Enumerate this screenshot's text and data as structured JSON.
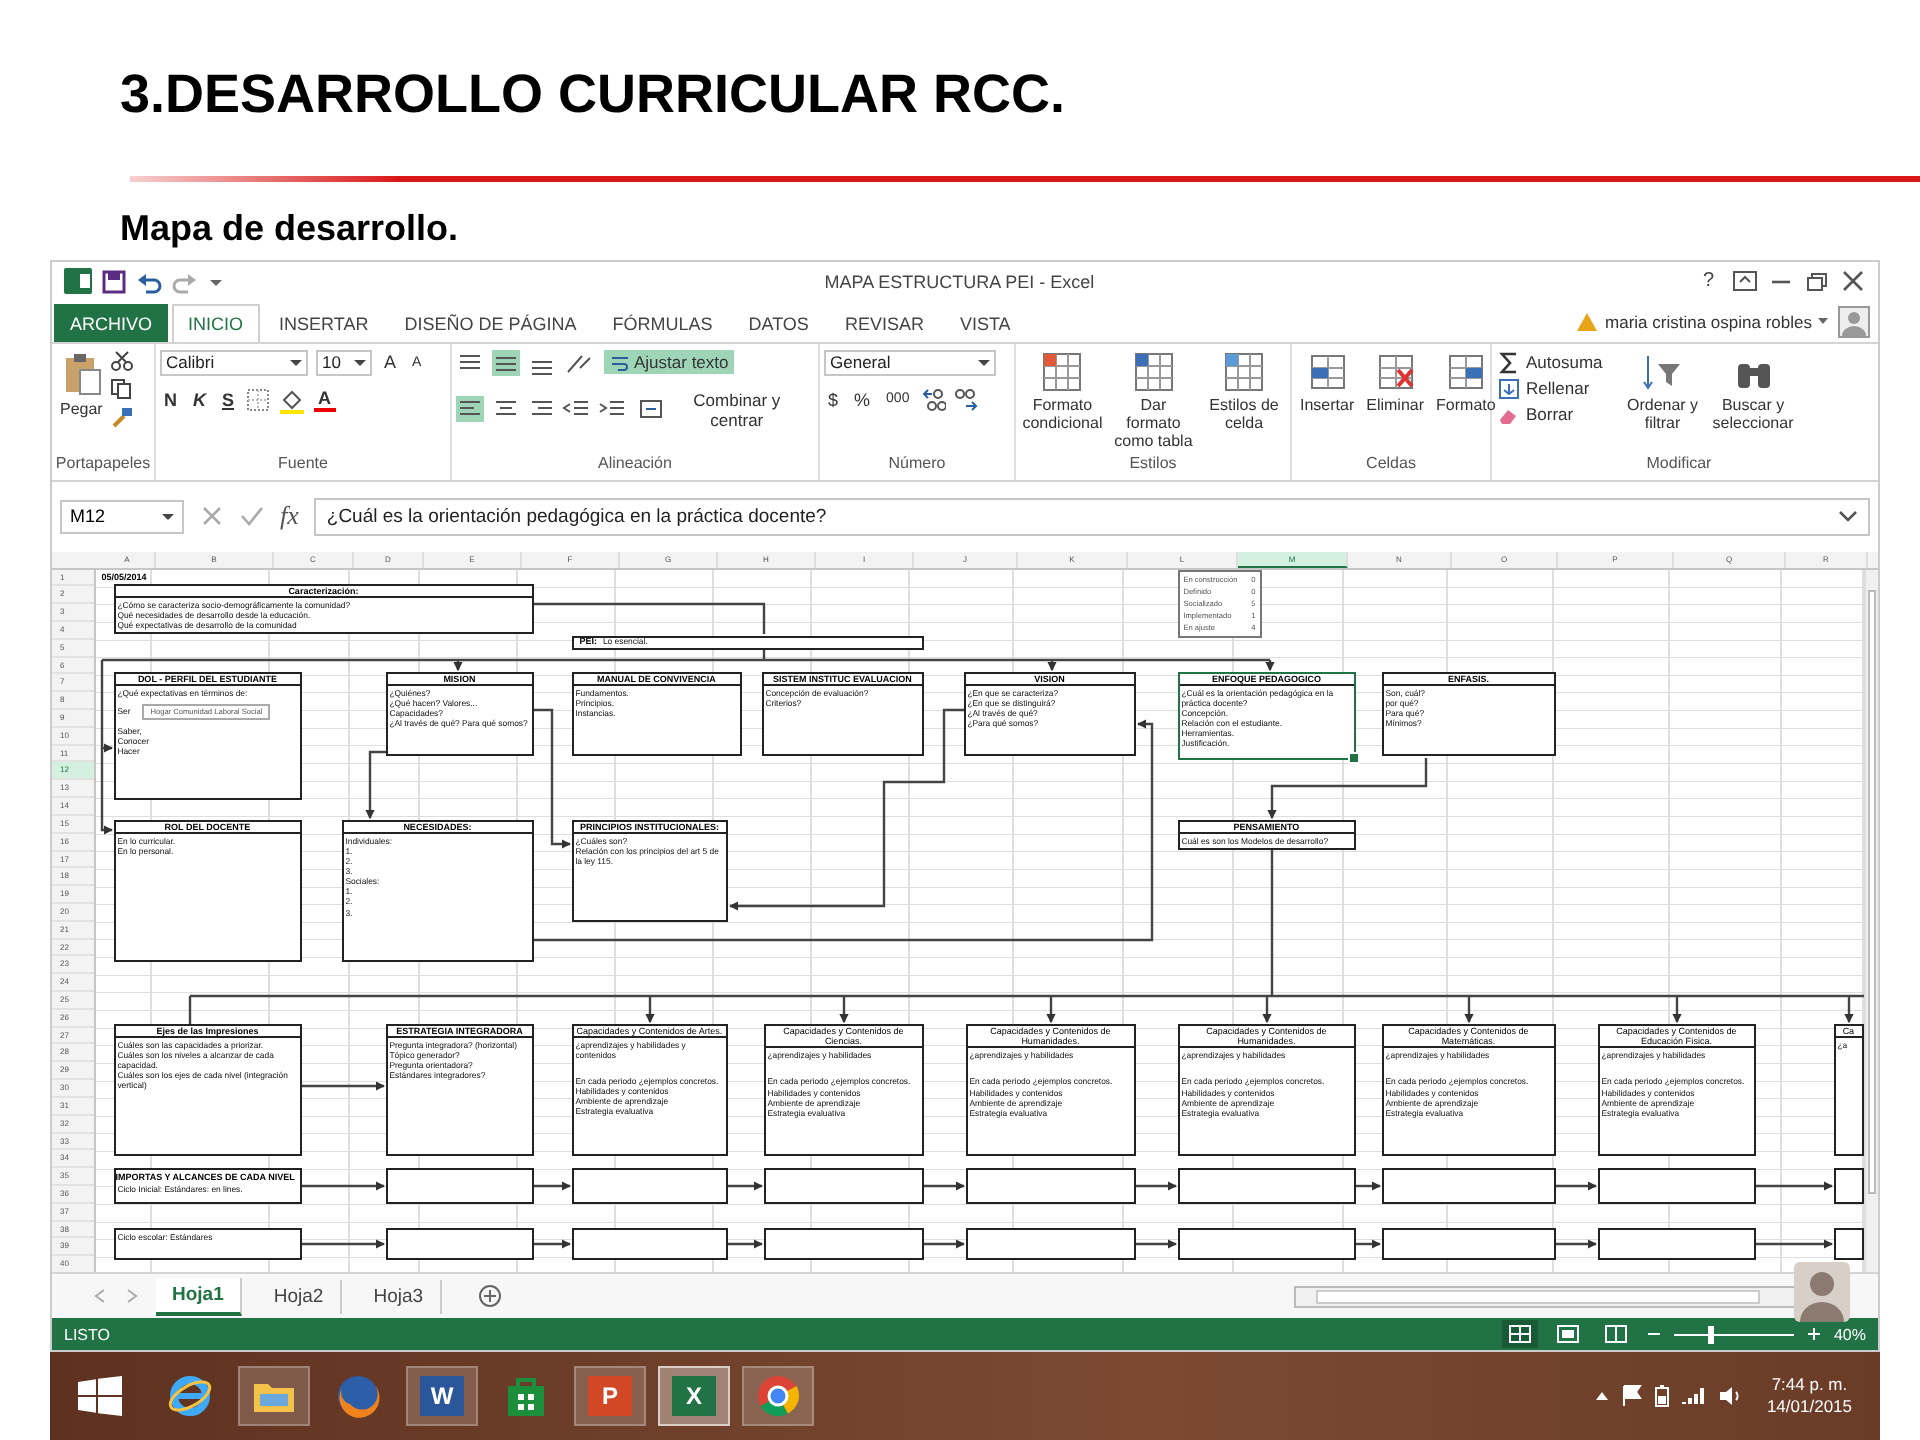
{
  "slide": {
    "title": "3.DESARROLLO CURRICULAR RCC.",
    "subtitle": "Mapa de desarrollo."
  },
  "window": {
    "title": "MAPA ESTRUCTURA PEI - Excel",
    "help": "?"
  },
  "tabs": [
    {
      "label": "ARCHIVO",
      "kind": "file",
      "selected": false
    },
    {
      "label": "INICIO",
      "kind": "tab",
      "selected": true
    },
    {
      "label": "INSERTAR",
      "kind": "tab",
      "selected": false
    },
    {
      "label": "DISEÑO DE PÁGINA",
      "kind": "tab",
      "selected": false
    },
    {
      "label": "FÓRMULAS",
      "kind": "tab",
      "selected": false
    },
    {
      "label": "DATOS",
      "kind": "tab",
      "selected": false
    },
    {
      "label": "REVISAR",
      "kind": "tab",
      "selected": false
    },
    {
      "label": "VISTA",
      "kind": "tab",
      "selected": false
    }
  ],
  "user": {
    "name": "maria cristina ospina robles"
  },
  "ribbon": {
    "clipboard": {
      "label": "Portapapeles",
      "paste": "Pegar"
    },
    "font": {
      "label": "Fuente",
      "family": "Calibri",
      "size": "10",
      "grow": "A",
      "shrink": "A",
      "bold": "N",
      "italic": "K",
      "underline": "S",
      "color_letter": "A"
    },
    "alignment": {
      "label": "Alineación",
      "middle_on": true,
      "left_on": true,
      "wrap": {
        "label": "Ajustar texto",
        "on": true
      },
      "merge": "Combinar y centrar"
    },
    "number": {
      "label": "Número",
      "format": "General",
      "currency": "$",
      "percent": "%",
      "thousands": "000"
    },
    "styles": {
      "label": "Estilos",
      "buttons": [
        [
          "Formato",
          "condicional"
        ],
        [
          "Dar formato",
          "como tabla"
        ],
        [
          "Estilos de",
          "celda"
        ]
      ]
    },
    "cells": {
      "label": "Celdas",
      "buttons": [
        "Insertar",
        "Eliminar",
        "Formato"
      ]
    },
    "editing": {
      "label": "Modificar",
      "small": [
        "Autosuma",
        "Rellenar",
        "Borrar"
      ],
      "large": [
        [
          "Ordenar y",
          "filtrar"
        ],
        [
          "Buscar y",
          "seleccionar"
        ]
      ]
    }
  },
  "formula_bar": {
    "name_box": "M12",
    "fx": "fx",
    "value": "¿Cuál es la orientación pedagógica  en la práctica docente?"
  },
  "sheet": {
    "columns": [
      {
        "label": "A",
        "selected": false
      },
      {
        "label": "B",
        "selected": false
      },
      {
        "label": "C",
        "selected": false
      },
      {
        "label": "D",
        "selected": false
      },
      {
        "label": "E",
        "selected": false
      },
      {
        "label": "F",
        "selected": false
      },
      {
        "label": "G",
        "selected": false
      },
      {
        "label": "H",
        "selected": false
      },
      {
        "label": "I",
        "selected": false
      },
      {
        "label": "J",
        "selected": false
      },
      {
        "label": "K",
        "selected": false
      },
      {
        "label": "L",
        "selected": false
      },
      {
        "label": "M",
        "selected": true
      },
      {
        "label": "N",
        "selected": false
      },
      {
        "label": "O",
        "selected": false
      },
      {
        "label": "P",
        "selected": false
      },
      {
        "label": "Q",
        "selected": false
      },
      {
        "label": "R",
        "selected": false
      }
    ],
    "rows": [
      {
        "label": "1",
        "selected": false
      },
      {
        "label": "2",
        "selected": false
      },
      {
        "label": "3",
        "selected": false
      },
      {
        "label": "4",
        "selected": false
      },
      {
        "label": "5",
        "selected": false
      },
      {
        "label": "6",
        "selected": false
      },
      {
        "label": "7",
        "selected": false
      },
      {
        "label": "8",
        "selected": false
      },
      {
        "label": "9",
        "selected": false
      },
      {
        "label": "10",
        "selected": false
      },
      {
        "label": "11",
        "selected": false
      },
      {
        "label": "12",
        "selected": true
      },
      {
        "label": "13",
        "selected": false
      },
      {
        "label": "14",
        "selected": false
      },
      {
        "label": "15",
        "selected": false
      },
      {
        "label": "16",
        "selected": false
      },
      {
        "label": "17",
        "selected": false
      },
      {
        "label": "18",
        "selected": false
      },
      {
        "label": "19",
        "selected": false
      },
      {
        "label": "20",
        "selected": false
      },
      {
        "label": "21",
        "selected": false
      },
      {
        "label": "22",
        "selected": false
      },
      {
        "label": "23",
        "selected": false
      },
      {
        "label": "24",
        "selected": false
      },
      {
        "label": "25",
        "selected": false
      },
      {
        "label": "26",
        "selected": false
      },
      {
        "label": "27",
        "selected": false
      },
      {
        "label": "28",
        "selected": false
      },
      {
        "label": "29",
        "selected": false
      },
      {
        "label": "30",
        "selected": false
      },
      {
        "label": "31",
        "selected": false
      },
      {
        "label": "32",
        "selected": false
      },
      {
        "label": "33",
        "selected": false
      },
      {
        "label": "34",
        "selected": false
      },
      {
        "label": "35",
        "selected": false
      },
      {
        "label": "36",
        "selected": false
      },
      {
        "label": "37",
        "selected": false
      },
      {
        "label": "38",
        "selected": false
      },
      {
        "label": "39",
        "selected": false
      },
      {
        "label": "40",
        "selected": false
      }
    ],
    "date": "05/05/2014",
    "nodes": [
      {
        "kind": "box",
        "title": "Caracterización:",
        "lines": [
          "¿Cómo se caracteriza socio-demográficamente la comunidad?",
          "Qué necesidades de desarrollo desde la educación.",
          "Qué expectativas de desarrollo de la comunidad"
        ],
        "selected": false
      },
      {
        "kind": "inline",
        "title": "PEI:",
        "lines": [
          "Lo esencial."
        ],
        "selected": false
      },
      {
        "kind": "box",
        "title": "DOL - PERFIL DEL ESTUDIANTE",
        "lines": [
          "¿Qué expectativas en términos de:",
          "Ser",
          "Saber,",
          "Conocer",
          "Hacer"
        ],
        "field": "Hogar  Comunidad  Laboral  Social",
        "selected": false
      },
      {
        "kind": "box",
        "title": "MISION",
        "lines": [
          "¿Quiénes?",
          "¿Qué hacen? Valores... Capacidades?",
          "¿Al través de qué? Para qué somos?"
        ],
        "selected": false
      },
      {
        "kind": "box",
        "title": "MANUAL DE CONVIVENCIA",
        "lines": [
          "Fundamentos.",
          "Principios.",
          "Instancias."
        ],
        "selected": false
      },
      {
        "kind": "box",
        "title": "SISTEM INSTITUC EVALUACION",
        "lines": [
          "Concepción de evaluación?",
          "Criterios?"
        ],
        "selected": false
      },
      {
        "kind": "box",
        "title": "VISION",
        "lines": [
          "¿En que se caracteriza?",
          "¿En que se distinguirá?",
          "¿Al través de qué?",
          "¿Para qué somos?"
        ],
        "selected": false
      },
      {
        "kind": "box",
        "title": "ENFOQUE PEDAGOGICO",
        "lines": [
          "¿Cuál es la orientación pedagógica en la práctica docente?",
          "Concepción.",
          "Relación con el estudiante.",
          "Herramientas.",
          "Justificación."
        ],
        "selected": true
      },
      {
        "kind": "box",
        "title": "ENFASIS.",
        "lines": [
          "Son, cuál?",
          "por qué?",
          "Para qué?",
          "Mínimos?"
        ],
        "selected": false
      },
      {
        "kind": "list",
        "items": [
          {
            "label": "En construcción",
            "value": "0"
          },
          {
            "label": "Definido",
            "value": "0"
          },
          {
            "label": "Socializado",
            "value": "5"
          },
          {
            "label": "Implementado",
            "value": "1"
          },
          {
            "label": "En ajuste",
            "value": "4"
          }
        ],
        "selected": false
      },
      {
        "kind": "box",
        "title": "ROL DEL DOCENTE",
        "lines": [
          "En lo curricular.",
          "En lo personal."
        ],
        "selected": false
      },
      {
        "kind": "box",
        "title": "NECESIDADES:",
        "lines": [
          "Individuales:",
          "1.",
          "2.",
          "3.",
          "Sociales:",
          "1.",
          "2.",
          "3."
        ],
        "selected": false
      },
      {
        "kind": "box",
        "title": "PRINCIPIOS INSTITUCIONALES:",
        "lines": [
          "¿Cuáles son?",
          "Relación con los principios del art 5 de la ley 115."
        ],
        "selected": false
      },
      {
        "kind": "box",
        "title": "PENSAMIENTO",
        "lines": [
          "Cuál es son los Modelos de desarrollo?"
        ],
        "selected": false
      },
      {
        "kind": "box",
        "title": "Ejes de las Impresiones",
        "lines": [
          "Cuáles son las capacidades a priorizar.",
          "Cuáles son los niveles a alcanzar de cada capacidad.",
          "Cuáles son los ejes de cada nivel (integración vertical)"
        ],
        "selected": false
      },
      {
        "kind": "box",
        "title": "ESTRATEGIA INTEGRADORA",
        "lines": [
          "Pregunta integradora? (horizontal)",
          "Tópico generador?",
          "Pregunta orientadora?",
          "Estándares integradores?"
        ],
        "selected": false
      }
    ],
    "areas": [
      {
        "title": "Capacidades y Contenidos de Artes.",
        "lines": [
          "¿aprendizajes y habilidades y contenidos",
          "En cada periodo ¿ejemplos concretos.",
          "Habilidades y contenidos",
          "Ambiente de aprendizaje",
          "Estrategia evaluativa"
        ]
      },
      {
        "title": "Capacidades y Contenidos de Ciencias.",
        "lines": [
          "¿aprendizajes y habilidades",
          "En cada periodo ¿ejemplos concretos.",
          "Habilidades y contenidos",
          "Ambiente de aprendizaje",
          "Estrategia evaluativa"
        ]
      },
      {
        "title": "Capacidades y Contenidos de Humanidades.",
        "lines": [
          "¿aprendizajes y habilidades",
          "En cada periodo ¿ejemplos concretos.",
          "Habilidades y contenidos",
          "Ambiente de aprendizaje",
          "Estrategia evaluativa"
        ]
      },
      {
        "title": "Capacidades y Contenidos de Humanidades.",
        "lines": [
          "¿aprendizajes y habilidades",
          "En cada periodo ¿ejemplos concretos.",
          "Habilidades y contenidos",
          "Ambiente de aprendizaje",
          "Estrategia evaluativa"
        ]
      },
      {
        "title": "Capacidades y Contenidos de Matemáticas.",
        "lines": [
          "¿aprendizajes y habilidades",
          "En cada periodo ¿ejemplos concretos.",
          "Habilidades y contenidos",
          "Ambiente de aprendizaje",
          "Estrategia evaluativa"
        ]
      },
      {
        "title": "Capacidades y Contenidos de Educación Física.",
        "lines": [
          "¿aprendizajes y habilidades",
          "En cada periodo ¿ejemplos concretos.",
          "Habilidades y contenidos",
          "Ambiente de aprendizaje",
          "Estrategia evaluativa"
        ]
      },
      {
        "title": "Ca",
        "lines": [
          "¿a"
        ]
      }
    ],
    "chain_rows": [
      {
        "title": "IMPORTAS Y ALCANCES DE CADA NIVEL",
        "text": "Ciclo Inicial: Estándares: en lines."
      },
      {
        "text": "Ciclo escolar: Estándares"
      }
    ]
  },
  "sheet_tabs": [
    {
      "label": "Hoja1",
      "selected": true
    },
    {
      "label": "Hoja2",
      "selected": false
    },
    {
      "label": "Hoja3",
      "selected": false
    }
  ],
  "status_bar": {
    "text": "LISTO",
    "views": [
      {
        "selected": true
      },
      {
        "selected": false
      },
      {
        "selected": false
      }
    ],
    "zoom": {
      "reading": "40%",
      "level": 0.3
    }
  },
  "taskbar": {
    "apps": [
      {
        "kind": "ie",
        "open": false,
        "selected": false
      },
      {
        "kind": "folder",
        "open": true,
        "selected": false
      },
      {
        "kind": "firefox",
        "open": false,
        "selected": false
      },
      {
        "kind": "office",
        "letter": "W",
        "color": "#2b579a",
        "open": true,
        "selected": false
      },
      {
        "kind": "store",
        "open": false,
        "selected": false
      },
      {
        "kind": "office",
        "letter": "P",
        "color": "#d24726",
        "open": true,
        "selected": false
      },
      {
        "kind": "office",
        "letter": "X",
        "color": "#217346",
        "open": true,
        "selected": true
      },
      {
        "kind": "chrome",
        "open": true,
        "selected": false
      }
    ],
    "time": "7:44 p. m.",
    "date": "14/01/2015"
  }
}
